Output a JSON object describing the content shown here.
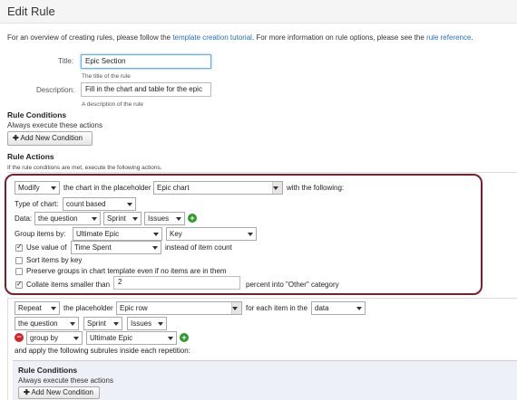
{
  "page": {
    "title": "Edit Rule",
    "intro_prefix": "For an overview of creating rules, please follow the",
    "intro_link1": "template creation tutorial",
    "intro_mid": ". For more information on rule options, please see the",
    "intro_link2": "rule reference",
    "intro_suffix": "."
  },
  "form": {
    "title_label": "Title:",
    "title_value": "Epic Section",
    "title_hint": "The title of the rule",
    "description_label": "Description:",
    "description_value": "Fill in the chart and table for the epic",
    "description_hint": "A description of the rule"
  },
  "conditions": {
    "heading": "Rule Conditions",
    "subtext": "Always execute these actions",
    "add_button": "Add New Condition"
  },
  "actions": {
    "heading": "Rule Actions",
    "subtext": "If the rule conditions are met, execute the following actions."
  },
  "action1": {
    "verb": "Modify",
    "text1": "the chart in the placeholder",
    "placeholder": "Epic chart",
    "text2": "with the following:",
    "type_label": "Type of chart:",
    "type_value": "count based",
    "data_label": "Data:",
    "data_values": [
      "the question",
      "Sprint",
      "Issues"
    ],
    "group_label": "Group items by:",
    "group_value": "Ultimate Epic",
    "group_key": "Key",
    "use_value_label": "Use value of",
    "use_value_field": "Time Spent",
    "use_value_suffix": "instead of item count",
    "sort_label": "Sort items by key",
    "preserve_label": "Preserve groups in chart template even if no items are in them",
    "collate_label": "Collate items smaller than",
    "collate_value": "2",
    "collate_suffix": "percent into \"Other\" category"
  },
  "action2": {
    "verb": "Repeat",
    "text1": "the placeholder",
    "placeholder": "Epic row",
    "text2": "for each item in the",
    "source": "data",
    "data_values": [
      "the question",
      "Sprint",
      "Issues"
    ],
    "group_by": "group by",
    "group_value": "Ultimate Epic",
    "apply_text": "and apply the following subrules inside each repetition:"
  },
  "subrule": {
    "heading": "Rule Conditions",
    "subtext": "Always execute these actions",
    "add_button": "Add New Condition"
  },
  "colors": {
    "link": "#2a6ebb",
    "highlight_border": "#7a1f2b",
    "add_icon": "#2e9a2e",
    "remove_icon": "#d0262a"
  }
}
